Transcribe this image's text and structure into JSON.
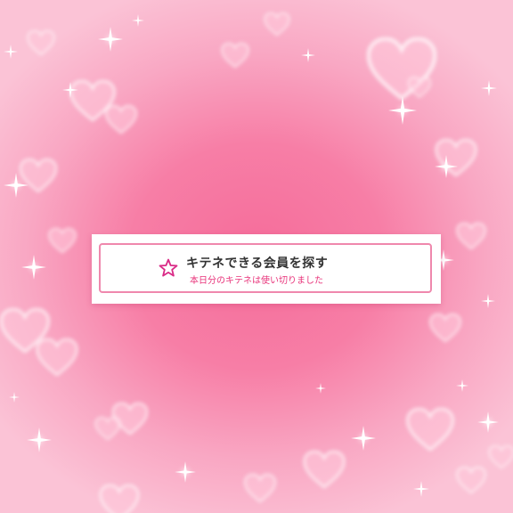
{
  "background": {
    "decoration": "pink-hearts-sparkles",
    "center_color": "#f56c9a",
    "edge_color": "#fbc3d6"
  },
  "card": {
    "title": "キテネできる会員を探す",
    "subtitle": "本日分のキテネは使い切りました",
    "icon": "star-outline-icon",
    "accent_color": "#e8337a",
    "border_color": "#ef88ad"
  }
}
